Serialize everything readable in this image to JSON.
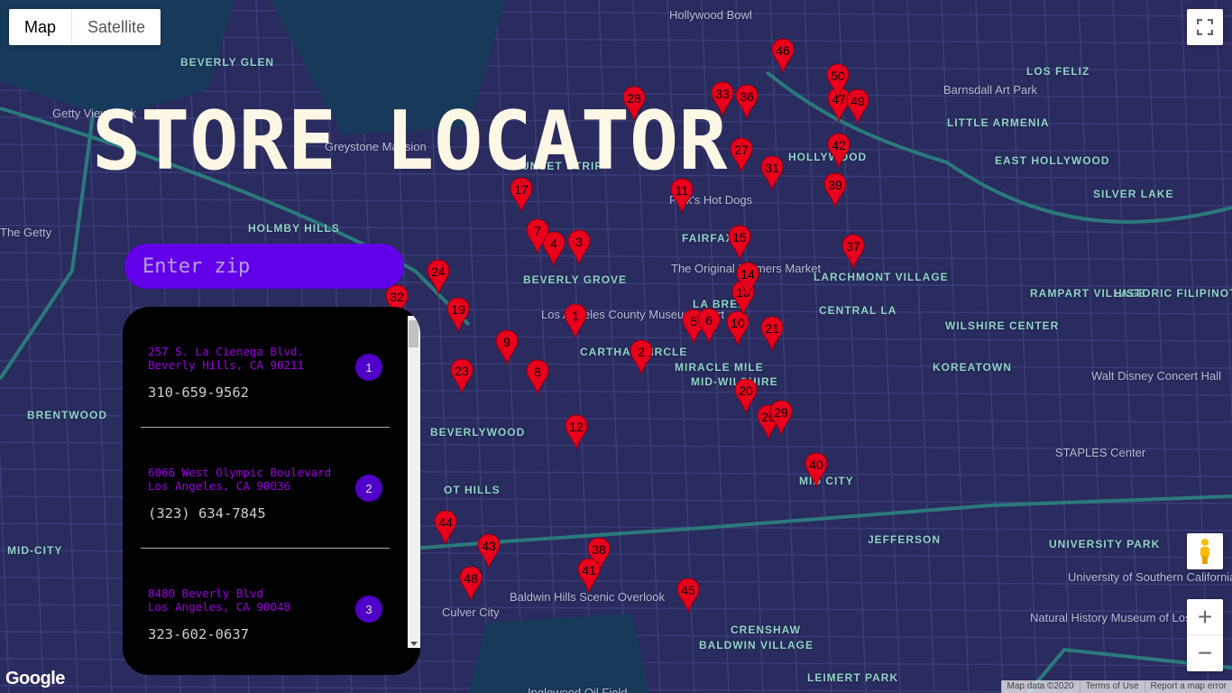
{
  "map_type": {
    "map": "Map",
    "satellite": "Satellite",
    "selected": "Map"
  },
  "title": "STORE LOCATOR",
  "search": {
    "placeholder": "Enter zip",
    "value": "",
    "icon": "search-icon"
  },
  "stores": [
    {
      "address1": "257 S. La Cienega Blvd.",
      "address2": "Beverly Hills, CA 90211",
      "phone": "310-659-9562",
      "number": "1"
    },
    {
      "address1": "6066 West Olympic Boulevard",
      "address2": "Los Angeles, CA 90036",
      "phone": "(323) 634-7845",
      "number": "2"
    },
    {
      "address1": "8480 Beverly Blvd",
      "address2": "Los Angeles, CA 90048",
      "phone": "323-602-0637",
      "number": "3"
    }
  ],
  "markers": [
    "1",
    "2",
    "3",
    "4",
    "5",
    "6",
    "7",
    "8",
    "9",
    "10",
    "11",
    "12",
    "13",
    "14",
    "15",
    "17",
    "19",
    "20",
    "21",
    "23",
    "24",
    "26",
    "27",
    "28",
    "29",
    "31",
    "32",
    "33",
    "36",
    "37",
    "38",
    "39",
    "40",
    "41",
    "42",
    "43",
    "44",
    "45",
    "46",
    "47",
    "48",
    "49",
    "50"
  ],
  "marker_color": "#e8001c",
  "map_labels": [
    "BEVERLY GLEN",
    "HOLMBY HILLS",
    "BRENTWOOD",
    "MID-CITY",
    "LOS FELIZ",
    "LITTLE ARMENIA",
    "EAST HOLLYWOOD",
    "SILVER LAKE",
    "LARCHMONT VILLAGE",
    "CENTRAL LA",
    "WILSHIRE CENTER",
    "KOREATOWN",
    "RAMPART VILLAGE",
    "HISTORIC FILIPINOTOWN",
    "FAIRFAX",
    "LA BREA",
    "BEVERLY GROVE",
    "CARTHAY CIRCLE",
    "MIRACLE MILE",
    "MID-WILSHIRE",
    "BEVERLYWOOD",
    "JEFFERSON",
    "UNIVERSITY PARK",
    "CRENSHAW",
    "BALDWIN VILLAGE",
    "LEIMERT PARK",
    "HOLLYWOOD",
    "SUNSET STRIP",
    "MID CITY",
    "OT HILLS",
    "Culver City",
    "Hollywood Bowl",
    "Getty View Park",
    "The Getty",
    "Greystone Mansion",
    "Pink's Hot Dogs",
    "Barnsdall Art Park",
    "Natural History Museum of Los...",
    "University of Southern California",
    "STAPLES Center",
    "Walt Disney Concert Hall",
    "Baldwin Hills Scenic Overlook",
    "Inglewood Oil Field",
    "The Original Farmers Market",
    "Los Angeles County Museum of Art"
  ],
  "attribution": {
    "map_data": "Map data ©2020",
    "terms": "Terms of Use",
    "report": "Report a map error",
    "logo": "Google"
  },
  "colors": {
    "accent": "#6200ea",
    "store_number": "#5000c8",
    "address": "#9b00e6",
    "map_bg": "#2a2b5e"
  }
}
